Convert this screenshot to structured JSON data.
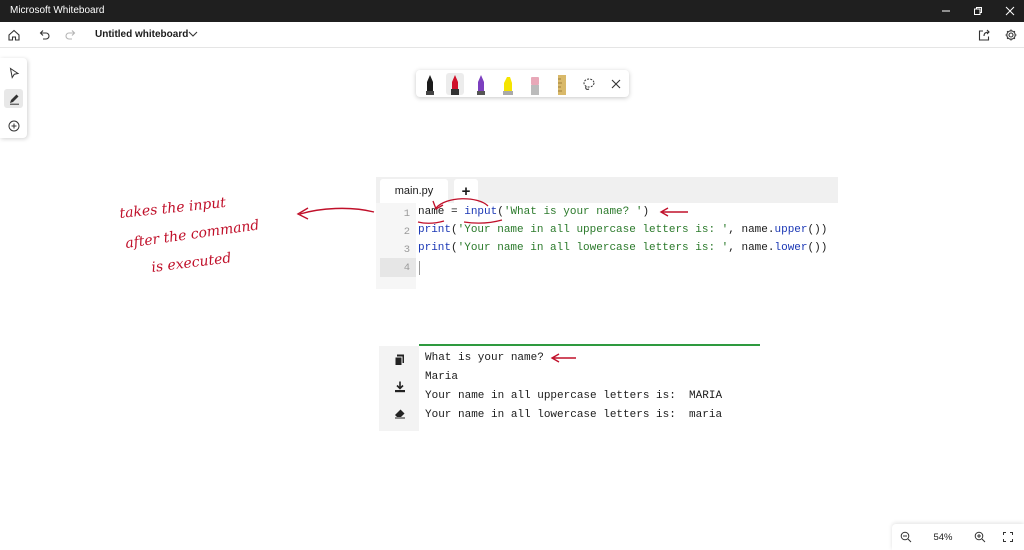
{
  "window": {
    "title": "Microsoft Whiteboard",
    "controls": [
      "minimize",
      "maximize",
      "close"
    ]
  },
  "header": {
    "board_title": "Untitled whiteboard",
    "icons": [
      "home-icon",
      "undo-icon",
      "redo-icon",
      "chevron-down-icon",
      "share-icon",
      "settings-icon"
    ]
  },
  "left_toolbar": {
    "tools": [
      "select-icon",
      "pen-icon",
      "add-icon"
    ],
    "active": "pen-icon"
  },
  "pen_toolbar": {
    "pens": [
      {
        "name": "black-pen",
        "color": "#1b1b1b"
      },
      {
        "name": "red-pen",
        "color": "#d0102a"
      },
      {
        "name": "purple-pen",
        "color": "#7c3fbf"
      },
      {
        "name": "yellow-highlighter",
        "color": "#f5e400"
      },
      {
        "name": "eraser",
        "color": "#e8a8b8"
      },
      {
        "name": "ruler",
        "color": "#d9b96a"
      }
    ],
    "icons": [
      "lasso-icon",
      "close-icon"
    ]
  },
  "editor": {
    "tab_label": "main.py",
    "add_tab_label": "+",
    "lines": [
      {
        "num": "1",
        "parts": [
          {
            "t": "name = ",
            "c": ""
          },
          {
            "t": "input",
            "c": "kw"
          },
          {
            "t": "(",
            "c": ""
          },
          {
            "t": "'What is your name? '",
            "c": "str"
          },
          {
            "t": ")",
            "c": ""
          }
        ]
      },
      {
        "num": "2",
        "parts": [
          {
            "t": "print",
            "c": "kw"
          },
          {
            "t": "(",
            "c": ""
          },
          {
            "t": "'Your name in all uppercase letters is: '",
            "c": "str"
          },
          {
            "t": ", name.",
            "c": ""
          },
          {
            "t": "upper",
            "c": "kw"
          },
          {
            "t": "())",
            "c": ""
          }
        ]
      },
      {
        "num": "3",
        "parts": [
          {
            "t": "print",
            "c": "kw"
          },
          {
            "t": "(",
            "c": ""
          },
          {
            "t": "'Your name in all lowercase letters is: '",
            "c": "str"
          },
          {
            "t": ", name.",
            "c": ""
          },
          {
            "t": "lower",
            "c": "kw"
          },
          {
            "t": "())",
            "c": ""
          }
        ]
      },
      {
        "num": "4",
        "parts": []
      }
    ]
  },
  "console": {
    "icons": [
      "copy-icon",
      "download-icon",
      "clear-icon"
    ],
    "lines": [
      "What is your name?",
      "Maria",
      "Your name in all uppercase letters is:  MARIA",
      "Your name in all lowercase letters is:  maria"
    ]
  },
  "annotation": {
    "lines": [
      "takes the input",
      "after the command",
      "is executed"
    ],
    "ink_color": "#c0102a"
  },
  "zoom": {
    "level": "54%"
  }
}
